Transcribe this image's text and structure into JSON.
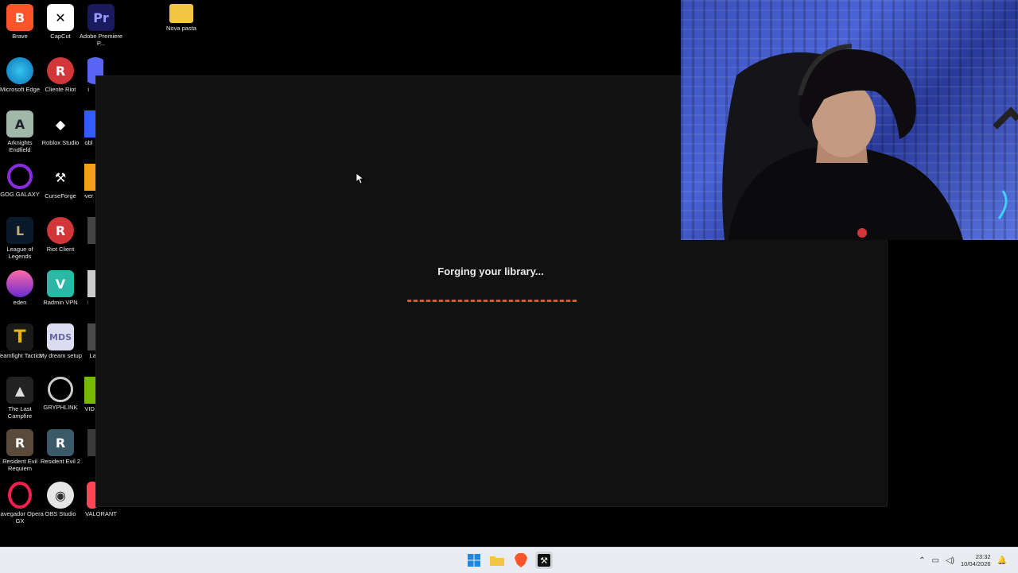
{
  "desktop_icons": [
    {
      "label": "Brave",
      "glyph": "🦁",
      "color": "#fb542b"
    },
    {
      "label": "CapCut",
      "glyph": "✕",
      "color": "#ffffff"
    },
    {
      "label": "Adobe Premiere P...",
      "glyph": "Pr",
      "color": "#1a1a5e"
    },
    {
      "label": "Nova pasta",
      "glyph": "📁",
      "color": "#f4c542"
    },
    {
      "label": "Microsoft Edge",
      "glyph": "◐",
      "color": "#1aa3d8"
    },
    {
      "label": "Cliente Riot",
      "glyph": "✊",
      "color": "#d13639"
    },
    {
      "label": "Di",
      "glyph": "◉",
      "color": "#5865f2"
    },
    {
      "label": "Arknights Endfield",
      "glyph": "A",
      "color": "#9fb8a8"
    },
    {
      "label": "Roblox Studio",
      "glyph": "◆",
      "color": "#222222"
    },
    {
      "label": "Robl",
      "glyph": "■",
      "color": "#335cff"
    },
    {
      "label": "GOG GALAXY",
      "glyph": "◯",
      "color": "#8a2be2"
    },
    {
      "label": "CurseForge",
      "glyph": "⚒",
      "color": "#222222"
    },
    {
      "label": "Over",
      "glyph": "◍",
      "color": "#f99e1a"
    },
    {
      "label": "League of Legends",
      "glyph": "L",
      "color": "#c8aa6e"
    },
    {
      "label": "Riot Client",
      "glyph": "✊",
      "color": "#d13639"
    },
    {
      "label": "S",
      "glyph": "S",
      "color": "#3a3a3a"
    },
    {
      "label": "eden",
      "glyph": "☀",
      "color": "#c03a8a"
    },
    {
      "label": "Radmin VPN",
      "glyph": "⛨",
      "color": "#2bb8a6"
    },
    {
      "label": "Li",
      "glyph": "▯",
      "color": "#cccccc"
    },
    {
      "label": "Teamfight Tactics",
      "glyph": "T",
      "color": "#e8b400"
    },
    {
      "label": "My dream setup",
      "glyph": "▦",
      "color": "#6a6aa8"
    },
    {
      "label": "H Lau",
      "glyph": "H",
      "color": "#4a4a4a"
    },
    {
      "label": "The Last Campfire",
      "glyph": "⛺",
      "color": "#3a3a3a"
    },
    {
      "label": "GRYPHLINK",
      "glyph": "◎",
      "color": "#444444"
    },
    {
      "label": "NVID",
      "glyph": "▲",
      "color": "#76b900"
    },
    {
      "label": "Resident Evil Requiem",
      "glyph": "R",
      "color": "#5a4a3a"
    },
    {
      "label": "Resident Evil 2",
      "glyph": "R",
      "color": "#3a5a6a"
    },
    {
      "label": "S",
      "glyph": "S",
      "color": "#3a3a3a"
    },
    {
      "label": "Navegador Opera GX",
      "glyph": "O",
      "color": "#fa1e4e"
    },
    {
      "label": "OBS Studio",
      "glyph": "◉",
      "color": "#302e31"
    },
    {
      "label": "VALORANT",
      "glyph": "V",
      "color": "#ff4655"
    }
  ],
  "app_window": {
    "loading_text": "Forging your library..."
  },
  "taskbar": {
    "apps": [
      {
        "name": "start",
        "glyph": "⊞"
      },
      {
        "name": "file-explorer",
        "glyph": "📁"
      },
      {
        "name": "brave",
        "glyph": "🦁"
      },
      {
        "name": "curseforge",
        "glyph": "⚒"
      }
    ],
    "clock_time": "23:32",
    "clock_date": "10/04/2026"
  },
  "colors": {
    "accent": "#e2543a",
    "window_bg": "#111111",
    "taskbar_bg": "#e9ecf0"
  }
}
